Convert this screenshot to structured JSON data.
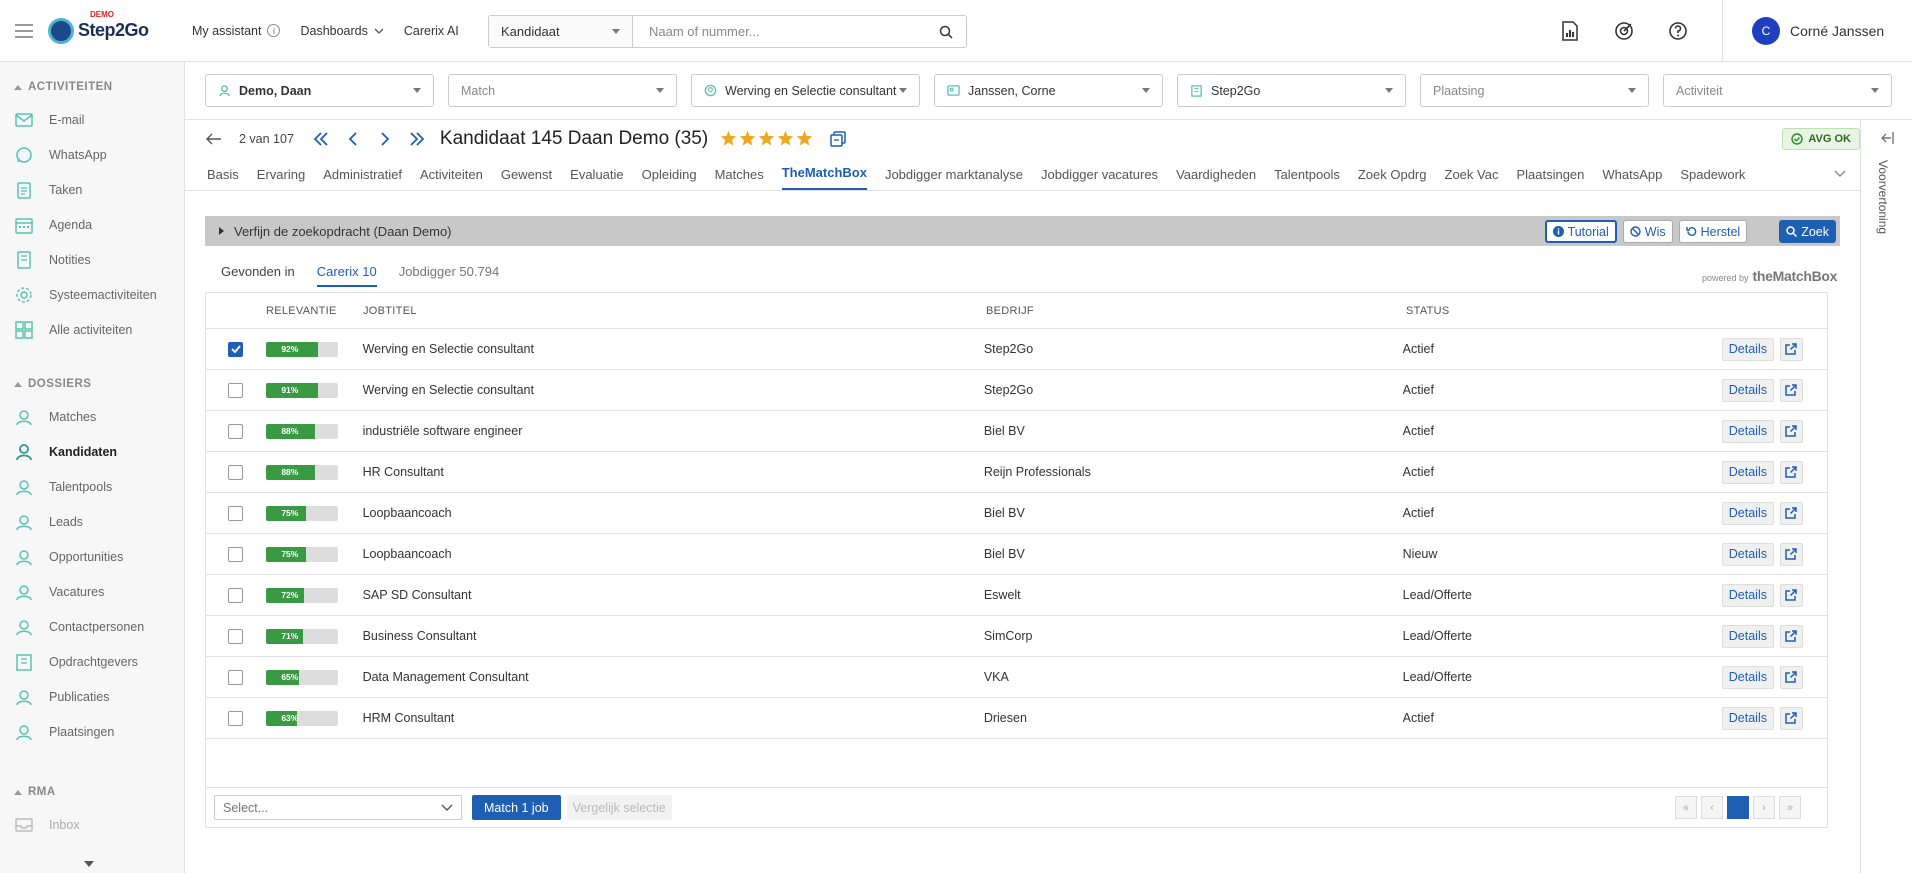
{
  "header": {
    "logo_text": "Step2Go",
    "logo_badge": "DEMO",
    "nav": [
      {
        "label": "My assistant"
      },
      {
        "label": "Dashboards"
      },
      {
        "label": "Carerix AI"
      }
    ],
    "search": {
      "scope": "Kandidaat",
      "placeholder": "Naam of nummer..."
    },
    "icons": [
      "report-icon",
      "target-icon",
      "help-icon"
    ],
    "user": {
      "initial": "C",
      "name": "Corné Janssen"
    }
  },
  "sidebar": {
    "sections": [
      {
        "title": "ACTIVITEITEN",
        "items": [
          {
            "label": "E-mail",
            "icon": "mail-icon"
          },
          {
            "label": "WhatsApp",
            "icon": "whatsapp-icon"
          },
          {
            "label": "Taken",
            "icon": "clipboard-icon"
          },
          {
            "label": "Agenda",
            "icon": "calendar-icon"
          },
          {
            "label": "Notities",
            "icon": "notes-icon"
          },
          {
            "label": "Systeemactiviteiten",
            "icon": "cog-icon"
          },
          {
            "label": "Alle activiteiten",
            "icon": "grid-icon"
          }
        ]
      },
      {
        "title": "DOSSIERS",
        "items": [
          {
            "label": "Matches",
            "icon": "handshake-icon"
          },
          {
            "label": "Kandidaten",
            "icon": "person-icon",
            "active": true
          },
          {
            "label": "Talentpools",
            "icon": "talent-icon"
          },
          {
            "label": "Leads",
            "icon": "lead-icon"
          },
          {
            "label": "Opportunities",
            "icon": "opportunity-icon"
          },
          {
            "label": "Vacatures",
            "icon": "vacancy-icon"
          },
          {
            "label": "Contactpersonen",
            "icon": "contacts-icon"
          },
          {
            "label": "Opdrachtgevers",
            "icon": "building-icon"
          },
          {
            "label": "Publicaties",
            "icon": "publication-icon"
          },
          {
            "label": "Plaatsingen",
            "icon": "placement-icon"
          }
        ]
      },
      {
        "title": "RMA",
        "items": [
          {
            "label": "Inbox",
            "icon": "inbox-icon"
          }
        ]
      }
    ]
  },
  "filters": [
    {
      "label": "Demo, Daan",
      "icon": "person",
      "bold": true
    },
    {
      "label": "Match",
      "placeholder": true
    },
    {
      "label": "Werving en Selectie consultant",
      "icon": "vacancy"
    },
    {
      "label": "Janssen, Corne",
      "icon": "contact"
    },
    {
      "label": "Step2Go",
      "icon": "building"
    },
    {
      "label": "Plaatsing",
      "placeholder": true
    },
    {
      "label": "Activiteit",
      "placeholder": true
    }
  ],
  "record": {
    "pager": "2 van 107",
    "title": "Kandidaat 145 Daan Demo (35)",
    "stars": 5,
    "avg_badge": "AVG OK"
  },
  "tabs": [
    "Basis",
    "Ervaring",
    "Administratief",
    "Activiteiten",
    "Gewenst",
    "Evaluatie",
    "Opleiding",
    "Matches",
    "TheMatchBox",
    "Jobdigger marktanalyse",
    "Jobdigger vacatures",
    "Vaardigheden",
    "Talentpools",
    "Zoek Opdrg",
    "Zoek Vac",
    "Plaatsingen",
    "WhatsApp",
    "Spadework"
  ],
  "active_tab": "TheMatchBox",
  "preview_label": "Voorvertoning",
  "matchbox": {
    "refine_label": "Verfijn de zoekopdracht (Daan Demo)",
    "buttons": {
      "tutorial": "Tutorial",
      "wis": "Wis",
      "herstel": "Herstel",
      "zoek": "Zoek"
    },
    "found_label": "Gevonden in",
    "sources": [
      {
        "label": "Carerix 10",
        "active": true
      },
      {
        "label": "Jobdigger 50.794",
        "active": false
      }
    ],
    "powered_by": "powered by",
    "powered_brand": "theMatchBox",
    "columns": {
      "relevance": "RELEVANTIE",
      "job": "JOBTITEL",
      "company": "BEDRIJF",
      "status": "STATUS"
    },
    "details_label": "Details",
    "rows": [
      {
        "checked": true,
        "relevance": 92,
        "job": "Werving en Selectie consultant",
        "company": "Step2Go",
        "status": "Actief"
      },
      {
        "checked": false,
        "relevance": 91,
        "job": "Werving en Selectie consultant",
        "company": "Step2Go",
        "status": "Actief"
      },
      {
        "checked": false,
        "relevance": 88,
        "job": "industriële software engineer",
        "company": "Biel BV",
        "status": "Actief"
      },
      {
        "checked": false,
        "relevance": 88,
        "job": "HR Consultant",
        "company": "Reijn Professionals",
        "status": "Actief"
      },
      {
        "checked": false,
        "relevance": 75,
        "job": "Loopbaancoach",
        "company": "Biel BV",
        "status": "Actief"
      },
      {
        "checked": false,
        "relevance": 75,
        "job": "Loopbaancoach",
        "company": "Biel BV",
        "status": "Nieuw"
      },
      {
        "checked": false,
        "relevance": 72,
        "job": "SAP SD Consultant",
        "company": "Eswelt",
        "status": "Lead/Offerte"
      },
      {
        "checked": false,
        "relevance": 71,
        "job": "Business Consultant",
        "company": "SimCorp",
        "status": "Lead/Offerte"
      },
      {
        "checked": false,
        "relevance": 65,
        "job": "Data Management Consultant",
        "company": "VKA",
        "status": "Lead/Offerte"
      },
      {
        "checked": false,
        "relevance": 63,
        "job": "HRM Consultant",
        "company": "Driesen",
        "status": "Actief"
      }
    ],
    "footer": {
      "select_placeholder": "Select...",
      "match_button": "Match 1 job",
      "compare_button": "Vergelijk selectie",
      "current_page": "1"
    }
  },
  "colors": {
    "primary": "#1f5fb3",
    "relevance_bar": "#3a9a44",
    "sidebar_icon": "#58c3b2"
  }
}
